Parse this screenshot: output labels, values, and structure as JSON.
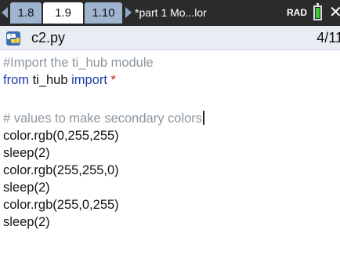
{
  "tabs": [
    {
      "label": "1.8",
      "active": false
    },
    {
      "label": "1.9",
      "active": true
    },
    {
      "label": "1.10",
      "active": false
    }
  ],
  "document_title": "*part 1 Mo...lor",
  "angle_mode": "RAD",
  "icons": {
    "tab_prev": "triangle-left-icon",
    "tab_next": "triangle-right-icon",
    "battery": "battery-icon",
    "close": "close-icon",
    "file": "python-icon"
  },
  "file": {
    "name": "c2.py",
    "line_counter": "4/11"
  },
  "code": {
    "line1": "#Import the ti_hub module",
    "line2_kw1": "from",
    "line2_mod": " ti_hub ",
    "line2_kw2": "import",
    "line2_star": " *",
    "line3": "",
    "line4": "# values to make secondary colors",
    "line5": "color.rgb(0,255,255)",
    "line6": "sleep(2)",
    "line7": "color.rgb(255,255,0)",
    "line8": "sleep(2)",
    "line9": "color.rgb(255,0,255)",
    "line10": "sleep(2)"
  },
  "colors": {
    "tab_bar_bg": "#2b2b2b",
    "tab_inactive": "#9fb4cf",
    "keyword": "#1c3fa8",
    "comment": "#8c96a0",
    "battery_level": "#33cc33"
  }
}
